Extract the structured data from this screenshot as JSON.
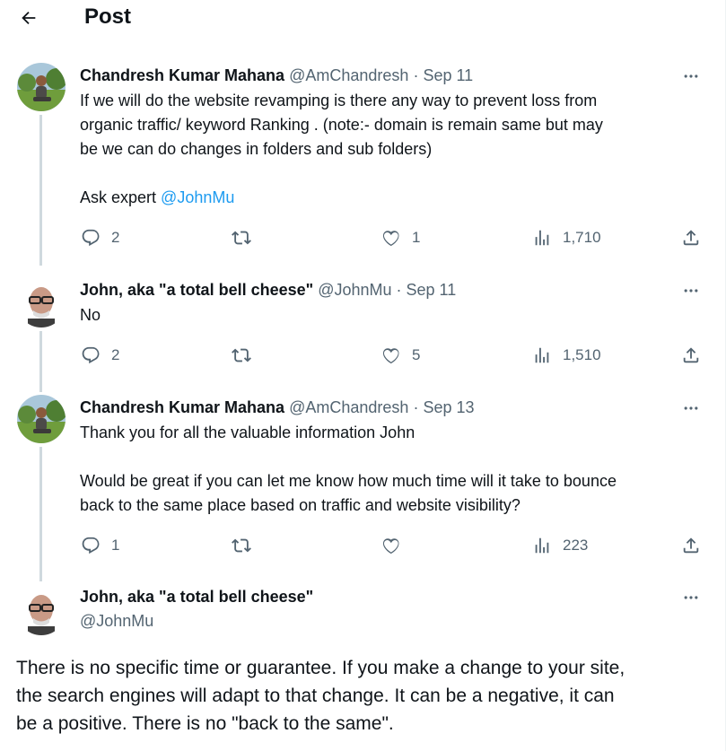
{
  "header": {
    "title": "Post"
  },
  "tweets": [
    {
      "name": "Chandresh Kumar Mahana",
      "handle": "@AmChandresh",
      "sep": "·",
      "date": "Sep 11",
      "body_line1": "If we will do the website revamping is there any way to prevent loss from",
      "body_line2": "organic traffic/ keyword Ranking . (note:- domain is remain same but may",
      "body_line3": "be we can do changes in folders and sub folders)",
      "ask_prefix": "Ask expert ",
      "ask_mention": "@JohnMu",
      "replies": "2",
      "likes": "1",
      "views": "1,710"
    },
    {
      "name": "John, aka \"a total bell cheese\"",
      "handle": "@JohnMu",
      "sep": "·",
      "date": "Sep 11",
      "body": "No",
      "replies": "2",
      "likes": "5",
      "views": "1,510"
    },
    {
      "name": "Chandresh Kumar Mahana",
      "handle": "@AmChandresh",
      "sep": "·",
      "date": "Sep 13",
      "body_line1": "Thank you for all the valuable information John",
      "body_line2": "Would be great if you can let me know how much time will it take to bounce",
      "body_line3": "back to the same place based on traffic and website visibility?",
      "replies": "1",
      "views": "223"
    }
  ],
  "main_tweet": {
    "name": "John, aka \"a total bell cheese\"",
    "handle": "@JohnMu",
    "text_line1": "There is no specific time or guarantee. If you make a change to your site,",
    "text_line2": "the search engines will adapt to that change. It can be a negative, it can",
    "text_line3": "be a positive. There is no \"back to the same\"."
  },
  "colors": {
    "text": "#0f1419",
    "secondary": "#536471",
    "link": "#1d9bf0",
    "thread_line": "#cfd9de"
  },
  "icons": [
    "back-arrow-icon",
    "more-icon",
    "reply-icon",
    "retweet-icon",
    "like-icon",
    "views-icon",
    "share-icon"
  ]
}
